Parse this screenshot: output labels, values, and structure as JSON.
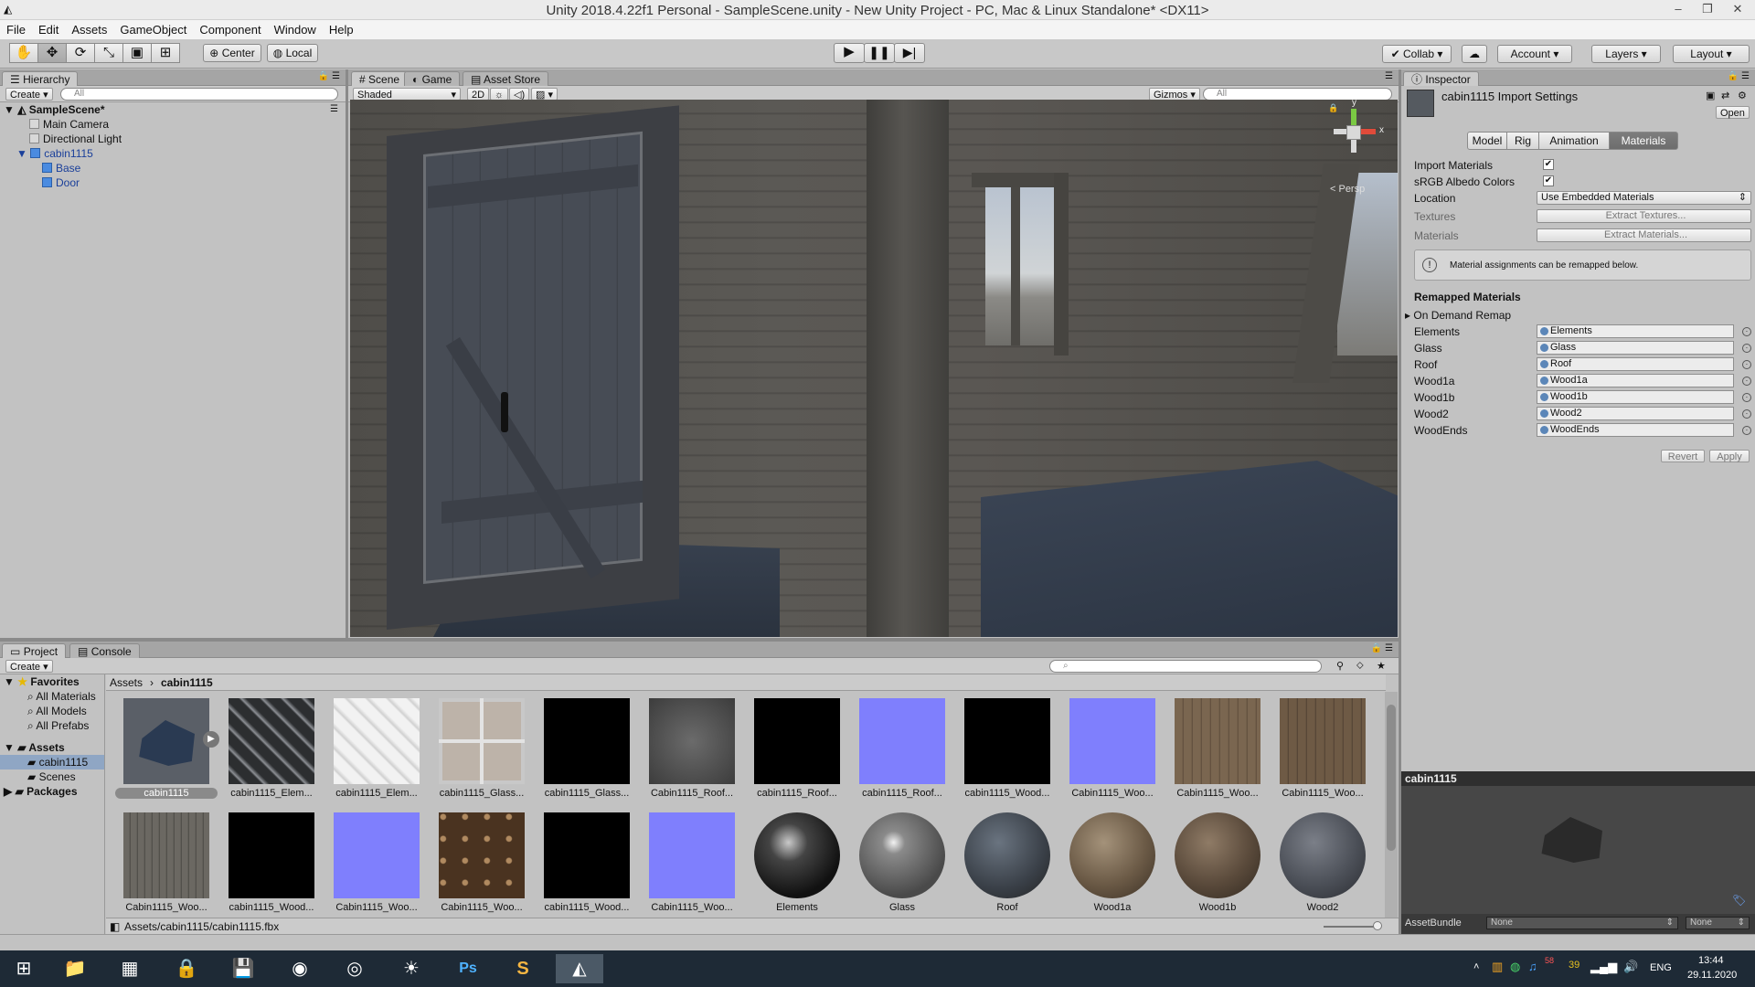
{
  "window": {
    "title": "Unity 2018.4.22f1 Personal - SampleScene.unity - New Unity Project - PC, Mac & Linux Standalone* <DX11>",
    "controls": [
      "–",
      "❐",
      "✕"
    ]
  },
  "menu": [
    "File",
    "Edit",
    "Assets",
    "GameObject",
    "Component",
    "Window",
    "Help"
  ],
  "toolbar": {
    "pivot": "Center",
    "space": "Local",
    "collab": "Collab",
    "account": "Account",
    "layers": "Layers",
    "layout": "Layout"
  },
  "hierarchy": {
    "tab": "Hierarchy",
    "create": "Create",
    "search_placeholder": "All",
    "scene": "SampleScene*",
    "items": [
      {
        "label": "Main Camera"
      },
      {
        "label": "Directional Light"
      },
      {
        "label": "cabin1115"
      },
      {
        "label": "Base"
      },
      {
        "label": "Door"
      }
    ]
  },
  "scene_view": {
    "tabs": [
      "Scene",
      "Game",
      "Asset Store"
    ],
    "shading": "Shaded",
    "mode_2d": "2D",
    "gizmos": "Gizmos",
    "search_placeholder": "All",
    "persp_label": "< Persp",
    "gizmo_axes": {
      "y": "y",
      "x": "x"
    }
  },
  "inspector": {
    "tab": "Inspector",
    "title": "cabin1115 Import Settings",
    "open": "Open",
    "tabs": [
      "Model",
      "Rig",
      "Animation",
      "Materials"
    ],
    "import_materials": {
      "label": "Import Materials",
      "checked": true
    },
    "srgb": {
      "label": "sRGB Albedo Colors",
      "checked": true
    },
    "location": {
      "label": "Location",
      "value": "Use Embedded Materials"
    },
    "textures": {
      "label": "Textures",
      "button": "Extract Textures..."
    },
    "materials": {
      "label": "Materials",
      "button": "Extract Materials..."
    },
    "info": "Material assignments can be remapped below.",
    "remapped_header": "Remapped Materials",
    "on_demand": "On Demand Remap",
    "remaps": [
      {
        "name": "Elements",
        "value": "Elements"
      },
      {
        "name": "Glass",
        "value": "Glass"
      },
      {
        "name": "Roof",
        "value": "Roof"
      },
      {
        "name": "Wood1a",
        "value": "Wood1a"
      },
      {
        "name": "Wood1b",
        "value": "Wood1b"
      },
      {
        "name": "Wood2",
        "value": "Wood2"
      },
      {
        "name": "WoodEnds",
        "value": "WoodEnds"
      }
    ],
    "revert": "Revert",
    "apply": "Apply"
  },
  "preview": {
    "title": "cabin1115",
    "assetbundle_label": "AssetBundle",
    "bundle": "None",
    "variant": "None"
  },
  "project": {
    "tabs": [
      "Project",
      "Console"
    ],
    "create": "Create",
    "favorites": {
      "label": "Favorites",
      "items": [
        "All Materials",
        "All Models",
        "All Prefabs"
      ]
    },
    "assets": {
      "label": "Assets",
      "items": [
        "cabin1115",
        "Scenes"
      ]
    },
    "packages": "Packages",
    "breadcrumb": [
      "Assets",
      "cabin1115"
    ],
    "grid": [
      {
        "label": "cabin1115"
      },
      {
        "label": "cabin1115_Elem..."
      },
      {
        "label": "cabin1115_Elem..."
      },
      {
        "label": "cabin1115_Glass..."
      },
      {
        "label": "cabin1115_Glass..."
      },
      {
        "label": "Cabin1115_Roof..."
      },
      {
        "label": "cabin1115_Roof..."
      },
      {
        "label": "cabin1115_Roof..."
      },
      {
        "label": "cabin1115_Wood..."
      },
      {
        "label": "Cabin1115_Woo..."
      },
      {
        "label": "Cabin1115_Woo..."
      },
      {
        "label": "Cabin1115_Woo..."
      },
      {
        "label": "Cabin1115_Woo..."
      },
      {
        "label": "cabin1115_Wood..."
      },
      {
        "label": "Cabin1115_Woo..."
      },
      {
        "label": "Cabin1115_Woo..."
      },
      {
        "label": "cabin1115_Wood..."
      },
      {
        "label": "Cabin1115_Woo..."
      },
      {
        "label": "Elements"
      },
      {
        "label": "Glass"
      },
      {
        "label": "Roof"
      },
      {
        "label": "Wood1a"
      },
      {
        "label": "Wood1b"
      },
      {
        "label": "Wood2"
      }
    ],
    "footer_path": "Assets/cabin1115/cabin1115.fbx"
  },
  "taskbar": {
    "lang": "ENG",
    "time": "13:44",
    "date": "29.11.2020",
    "tray_numbers": [
      "58",
      "39"
    ]
  }
}
